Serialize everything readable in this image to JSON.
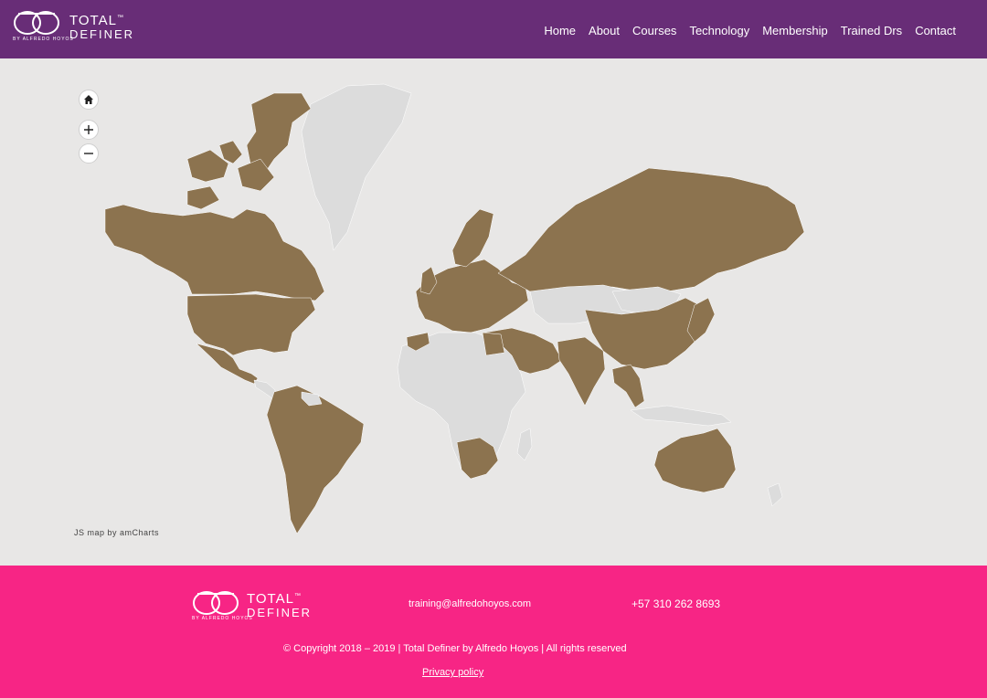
{
  "brand": {
    "line1": "TOTAL",
    "tm": "™",
    "line2": "DEFINER",
    "by": "BY ALFREDO HOYOS",
    "color_primary": "#682d77",
    "color_footer": "#f72585",
    "map_color": "#8c734f"
  },
  "nav": {
    "items": [
      "Home",
      "About",
      "Courses",
      "Technology",
      "Membership",
      "Trained Drs",
      "Contact"
    ]
  },
  "map": {
    "controls": {
      "home_icon": "home-icon",
      "zoom_in_icon": "plus-icon",
      "zoom_out_icon": "minus-icon"
    },
    "credit": "JS map by amCharts"
  },
  "footer": {
    "email": "training@alfredohoyos.com",
    "phone": "+57 310 262 8693",
    "copyright": "© Copyright 2018 – 2019 |  Total Definer by Alfredo Hoyos | All rights reserved",
    "privacy": "Privacy policy"
  }
}
